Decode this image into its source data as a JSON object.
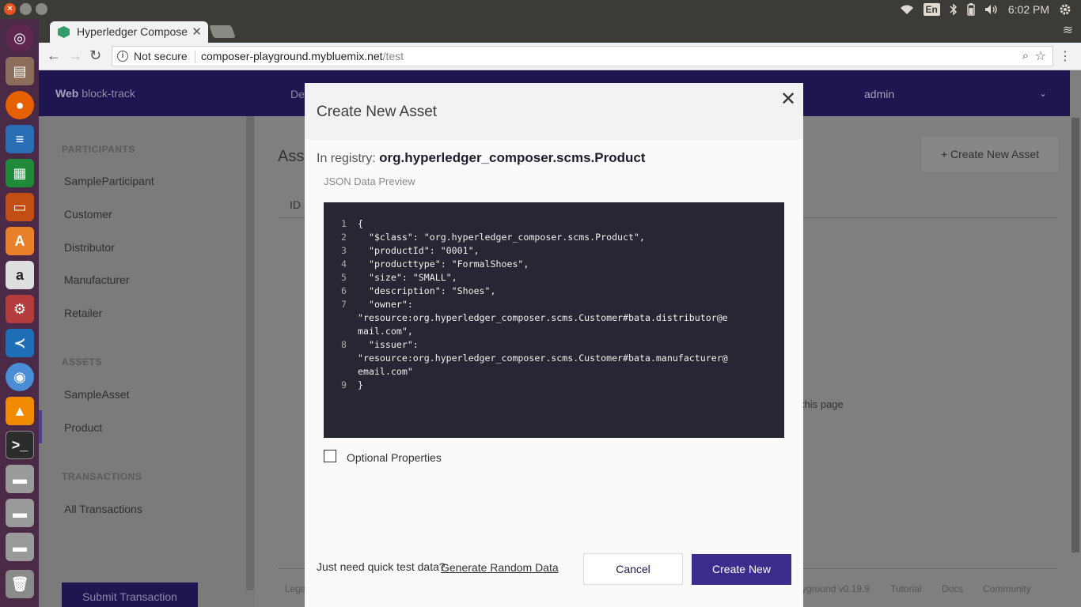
{
  "os": {
    "lang": "En",
    "clock": "6:02 PM"
  },
  "browser": {
    "tab_title": "Hyperledger Composer Playground",
    "security": "Not secure",
    "url_host": "composer-playground.mybluemix.net",
    "url_path": "/test"
  },
  "app": {
    "brand_bold": "Web",
    "brand_rest": " block-track",
    "header_tab": "De",
    "user": "admin"
  },
  "sidebar": {
    "participants_heading": "PARTICIPANTS",
    "participants": [
      "SampleParticipant",
      "Customer",
      "Distributor",
      "Manufacturer",
      "Retailer"
    ],
    "assets_heading": "ASSETS",
    "assets": [
      "SampleAsset",
      "Product"
    ],
    "transactions_heading": "TRANSACTIONS",
    "transactions": [
      "All Transactions"
    ],
    "submit_label": "Submit Transaction"
  },
  "main": {
    "title": "Asse",
    "create_button": "+ Create New Asset",
    "col_id": "ID",
    "empty_text": "this page",
    "footer": {
      "legal": "Lega",
      "version": "yground v0.19.9",
      "tutorial": "Tutorial",
      "docs": "Docs",
      "community": "Community"
    }
  },
  "modal": {
    "title": "Create New Asset",
    "registry_prefix": "In registry: ",
    "registry_name": "org.hyperledger_composer.scms.Product",
    "json_label": "JSON Data Preview",
    "code": [
      {
        "n": "1",
        "t": "{"
      },
      {
        "n": "2",
        "t": "  \"$class\": \"org.hyperledger_composer.scms.Product\","
      },
      {
        "n": "3",
        "t": "  \"productId\": \"0001\","
      },
      {
        "n": "4",
        "t": "  \"producttype\": \"FormalShoes\","
      },
      {
        "n": "5",
        "t": "  \"size\": \"SMALL\","
      },
      {
        "n": "6",
        "t": "  \"description\": \"Shoes\","
      },
      {
        "n": "7",
        "t": "  \"owner\":"
      },
      {
        "n": "",
        "t": "\"resource:org.hyperledger_composer.scms.Customer#bata.distributor@e"
      },
      {
        "n": "",
        "t": "mail.com\","
      },
      {
        "n": "8",
        "t": "  \"issuer\":"
      },
      {
        "n": "",
        "t": "\"resource:org.hyperledger_composer.scms.Customer#bata.manufacturer@"
      },
      {
        "n": "",
        "t": "email.com\""
      },
      {
        "n": "9",
        "t": "}"
      }
    ],
    "optional_label": "Optional Properties",
    "quick_text": "Just need quick test data?",
    "quick_link": "Generate Random Data",
    "cancel": "Cancel",
    "create": "Create New"
  }
}
